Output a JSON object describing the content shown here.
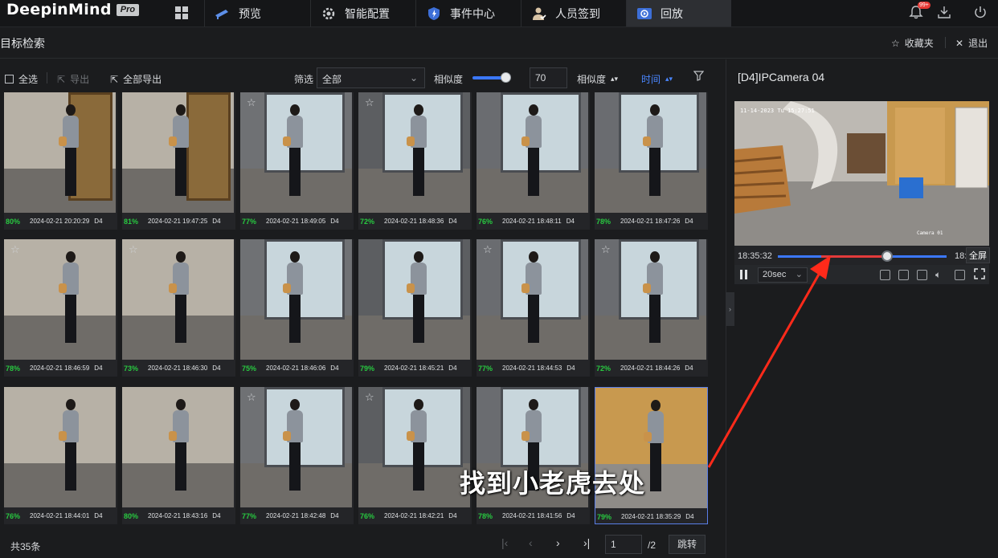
{
  "app": {
    "brand": "DeepinMind",
    "edition": "Pro"
  },
  "nav": {
    "tabs": [
      {
        "label": "预览",
        "icon": "camera-icon"
      },
      {
        "label": "智能配置",
        "icon": "ai-gear-icon"
      },
      {
        "label": "事件中心",
        "icon": "event-shield-icon"
      },
      {
        "label": "人员签到",
        "icon": "person-checkin-icon"
      },
      {
        "label": "回放",
        "icon": "playback-icon",
        "active": true
      }
    ],
    "notification_badge": "99+"
  },
  "page": {
    "title": "目标检索",
    "favorites_label": "收藏夹",
    "exit_label": "退出"
  },
  "toolbar": {
    "select_all": "全选",
    "export": "导出",
    "export_all": "全部导出",
    "filter_label": "筛选",
    "filter_value": "全部",
    "similarity_label": "相似度",
    "similarity_value": "70",
    "similarity_level": 0.7,
    "sort_similarity": "相似度",
    "sort_time": "时间"
  },
  "results": [
    {
      "pct": "80%",
      "ts": "2024-02-21 20:20:29",
      "ch": "D4",
      "star": false
    },
    {
      "pct": "81%",
      "ts": "2024-02-21 19:47:25",
      "ch": "D4",
      "star": false
    },
    {
      "pct": "77%",
      "ts": "2024-02-21 18:49:05",
      "ch": "D4",
      "star": true
    },
    {
      "pct": "72%",
      "ts": "2024-02-21 18:48:36",
      "ch": "D4",
      "star": true
    },
    {
      "pct": "76%",
      "ts": "2024-02-21 18:48:11",
      "ch": "D4",
      "star": false
    },
    {
      "pct": "78%",
      "ts": "2024-02-21 18:47:26",
      "ch": "D4",
      "star": false
    },
    {
      "pct": "78%",
      "ts": "2024-02-21 18:46:59",
      "ch": "D4",
      "star": true
    },
    {
      "pct": "73%",
      "ts": "2024-02-21 18:46:30",
      "ch": "D4",
      "star": true
    },
    {
      "pct": "75%",
      "ts": "2024-02-21 18:46:06",
      "ch": "D4",
      "star": false
    },
    {
      "pct": "79%",
      "ts": "2024-02-21 18:45:21",
      "ch": "D4",
      "star": false
    },
    {
      "pct": "77%",
      "ts": "2024-02-21 18:44:53",
      "ch": "D4",
      "star": true
    },
    {
      "pct": "72%",
      "ts": "2024-02-21 18:44:26",
      "ch": "D4",
      "star": true
    },
    {
      "pct": "76%",
      "ts": "2024-02-21 18:44:01",
      "ch": "D4",
      "star": false
    },
    {
      "pct": "80%",
      "ts": "2024-02-21 18:43:16",
      "ch": "D4",
      "star": false
    },
    {
      "pct": "77%",
      "ts": "2024-02-21 18:42:48",
      "ch": "D4",
      "star": true
    },
    {
      "pct": "76%",
      "ts": "2024-02-21 18:42:21",
      "ch": "D4",
      "star": true
    },
    {
      "pct": "78%",
      "ts": "2024-02-21 18:41:56",
      "ch": "D4",
      "star": false
    },
    {
      "pct": "79%",
      "ts": "2024-02-21 18:35:29",
      "ch": "D4",
      "star": false,
      "selected": true
    }
  ],
  "pagination": {
    "total": "共35条",
    "current": "1",
    "total_pages": "/2",
    "jump": "跳转"
  },
  "player": {
    "camera_title": "[D4]IPCamera 04",
    "osd_time": "11-14-2023 Tu 15:27:51",
    "camera_label": "Camera 01",
    "time_start": "18:35:32",
    "time_end": "18:",
    "fullscreen_tooltip": "全屏",
    "speed": "20sec",
    "progress": 0.61
  },
  "overlay": {
    "subtitle": "找到小老虎去处"
  },
  "colors": {
    "accent": "#3b78ff",
    "similarity_green": "#28c940",
    "progress_red": "#e23b3b",
    "arrow_red": "#ff2a1a"
  }
}
